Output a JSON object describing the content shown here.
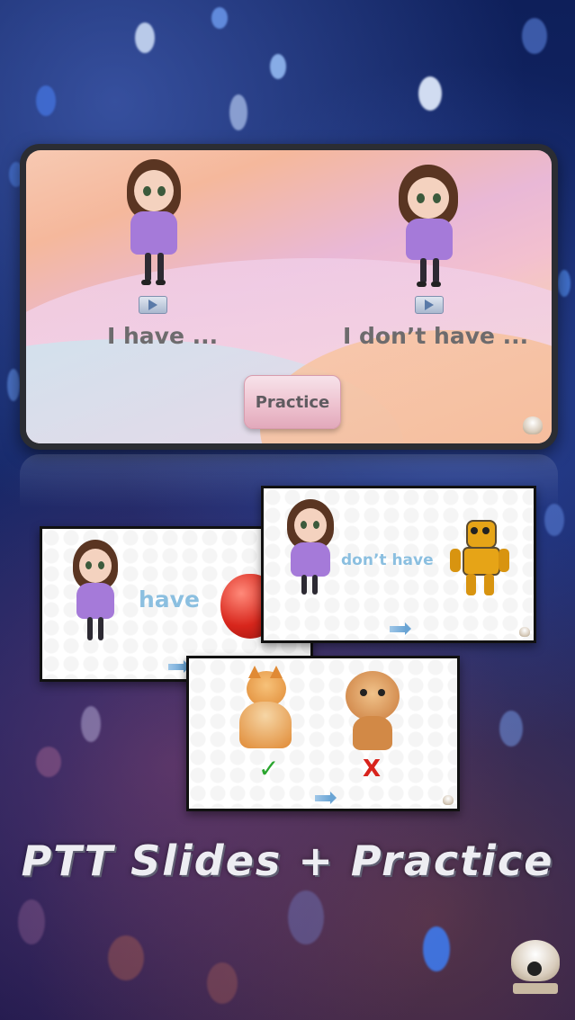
{
  "top_slide": {
    "left_caption": "I have ...",
    "right_caption": "I don’t have ...",
    "practice_label": "Practice"
  },
  "slide_have": {
    "word": "have"
  },
  "slide_dont_have": {
    "word": "don’t have"
  },
  "slide_check": {
    "check_mark": "✓",
    "cross_mark": "X"
  },
  "banner": {
    "title": "PTT Slides + Practice"
  }
}
